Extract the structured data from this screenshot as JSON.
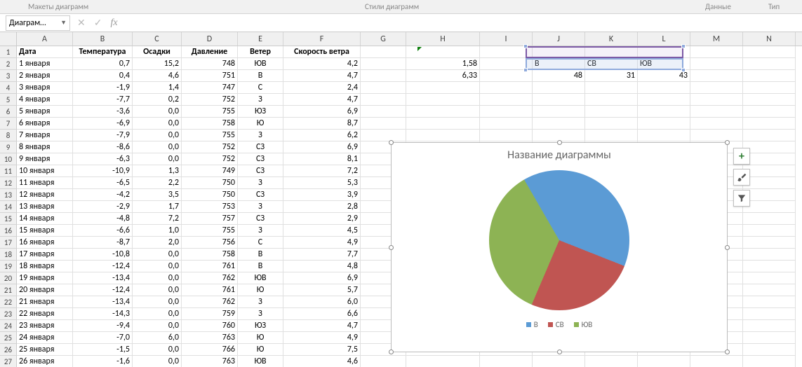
{
  "ribbon": {
    "layouts": "Макеты диаграмм",
    "styles": "Стили диаграмм",
    "data": "Данные",
    "type": "Тип"
  },
  "nameBox": "Диаграм…",
  "columns": [
    "A",
    "B",
    "C",
    "D",
    "E",
    "F",
    "G",
    "H",
    "I",
    "J",
    "K",
    "L",
    "M",
    "N"
  ],
  "headers": [
    "Дата",
    "Температура",
    "Осадки",
    "Давление",
    "Ветер",
    "Скорость ветра"
  ],
  "table": [
    [
      "1 января",
      "0,7",
      "15,2",
      "748",
      "ЮВ",
      "4,2"
    ],
    [
      "2 января",
      "0,4",
      "4,6",
      "751",
      "В",
      "4,7"
    ],
    [
      "3 января",
      "-1,9",
      "1,4",
      "747",
      "С",
      "2,4"
    ],
    [
      "4 января",
      "-7,7",
      "0,2",
      "752",
      "З",
      "4,7"
    ],
    [
      "5 января",
      "-3,6",
      "0,0",
      "755",
      "ЮЗ",
      "6,9"
    ],
    [
      "6 января",
      "-6,9",
      "0,0",
      "758",
      "Ю",
      "8,7"
    ],
    [
      "7 января",
      "-7,9",
      "0,0",
      "755",
      "З",
      "6,2"
    ],
    [
      "8 января",
      "-8,6",
      "0,0",
      "752",
      "СЗ",
      "6,9"
    ],
    [
      "9 января",
      "-6,3",
      "0,0",
      "752",
      "СЗ",
      "8,1"
    ],
    [
      "10 января",
      "-10,9",
      "1,3",
      "749",
      "СЗ",
      "7,2"
    ],
    [
      "11 января",
      "-6,5",
      "2,2",
      "750",
      "З",
      "5,3"
    ],
    [
      "12 января",
      "-4,2",
      "3,5",
      "750",
      "СЗ",
      "3,9"
    ],
    [
      "13 января",
      "-2,9",
      "1,7",
      "753",
      "З",
      "2,8"
    ],
    [
      "14 января",
      "-4,8",
      "7,2",
      "757",
      "СЗ",
      "2,9"
    ],
    [
      "15 января",
      "-6,6",
      "1,0",
      "755",
      "З",
      "4,5"
    ],
    [
      "16 января",
      "-8,7",
      "2,0",
      "756",
      "С",
      "4,9"
    ],
    [
      "17 января",
      "-10,8",
      "0,0",
      "758",
      "В",
      "7,7"
    ],
    [
      "18 января",
      "-12,4",
      "0,0",
      "761",
      "В",
      "4,8"
    ],
    [
      "19 января",
      "-13,4",
      "0,0",
      "762",
      "ЮВ",
      "6,9"
    ],
    [
      "20 января",
      "-12,4",
      "0,0",
      "761",
      "Ю",
      "5,7"
    ],
    [
      "21 января",
      "-13,4",
      "0,0",
      "762",
      "З",
      "6,0"
    ],
    [
      "22 января",
      "-14,3",
      "0,0",
      "759",
      "З",
      "6,6"
    ],
    [
      "23 января",
      "-9,4",
      "0,0",
      "760",
      "ЮЗ",
      "4,7"
    ],
    [
      "24 января",
      "-7,0",
      "6,0",
      "763",
      "Ю",
      "4,9"
    ],
    [
      "25 января",
      "-1,5",
      "0,0",
      "766",
      "Ю",
      "7,5"
    ],
    [
      "26 января",
      "-1,6",
      "0,0",
      "763",
      "ЮВ",
      "4,6"
    ]
  ],
  "extra": {
    "H2": "1,58",
    "H3": "6,33",
    "J2": "В",
    "K2": "СВ",
    "L2": "ЮВ",
    "J3": "48",
    "K3": "31",
    "L3": "43"
  },
  "chart_data": {
    "type": "pie",
    "title": "Название диаграммы",
    "categories": [
      "В",
      "СВ",
      "ЮВ"
    ],
    "values": [
      48,
      31,
      43
    ],
    "colors": [
      "#5b9bd5",
      "#c05552",
      "#8db354"
    ]
  },
  "rowCount": 27
}
